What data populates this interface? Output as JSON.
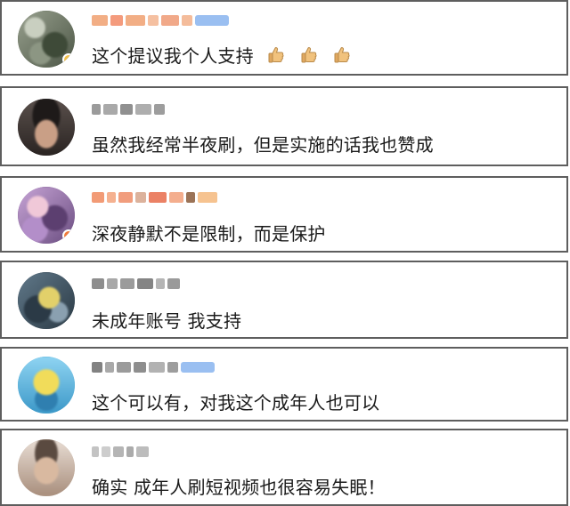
{
  "comments": [
    {
      "text": "这个提议我个人支持",
      "emojis": [
        "thumbs-up-icon",
        "thumbs-up-icon",
        "thumbs-up-icon"
      ]
    },
    {
      "text": "虽然我经常半夜刷，但是实施的话我也赞成"
    },
    {
      "text": "深夜静默不是限制，而是保护"
    },
    {
      "text": "未成年账号  我支持"
    },
    {
      "text": "这个可以有，对我这个成年人也可以"
    },
    {
      "text": "确实 成年人刷短视频也很容易失眠！"
    }
  ],
  "colors": {
    "border": "#5e5e5e",
    "text": "#1a1a1a",
    "vip_badge": "#8fb8f0",
    "orange_name": "#f0a070"
  }
}
